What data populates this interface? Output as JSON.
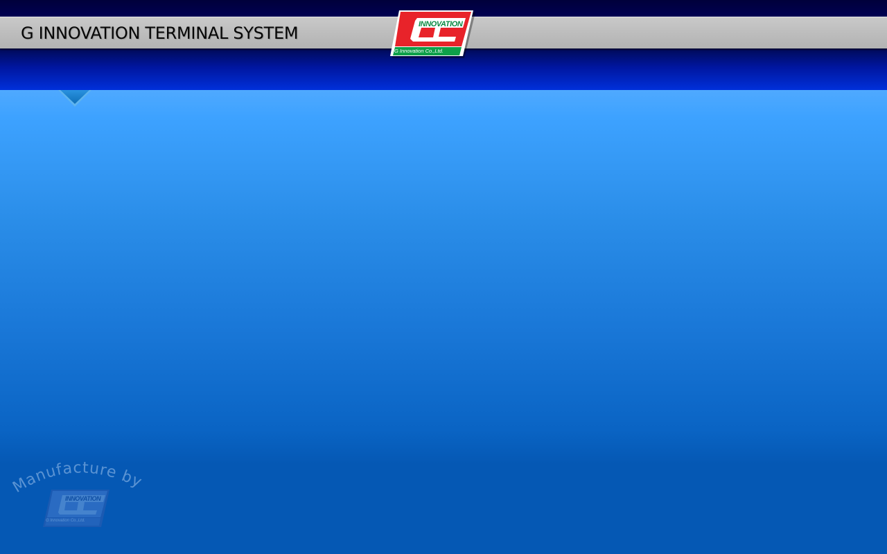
{
  "window": {
    "title": "G INNOVATION TERMINAL SYSTEM"
  },
  "logo": {
    "brand_word": "INNOVATION",
    "company": "G Innovation Co.,Ltd.",
    "icon": "g-innovation-logo-icon",
    "colors": {
      "red": "#e8232a",
      "green": "#0ea04a"
    }
  },
  "menu_toggle": {
    "icon": "triangle-down-icon"
  },
  "watermark": {
    "text": "Manufacture by",
    "brand_word": "INNOVATION",
    "company": "G Innovation Co.,Ltd."
  },
  "colors": {
    "header_bar": "#bdbdbd",
    "top_strip": "#000046",
    "band": "#0020b8",
    "background_top": "#8cc3ff",
    "background_bottom": "#0558b4"
  }
}
